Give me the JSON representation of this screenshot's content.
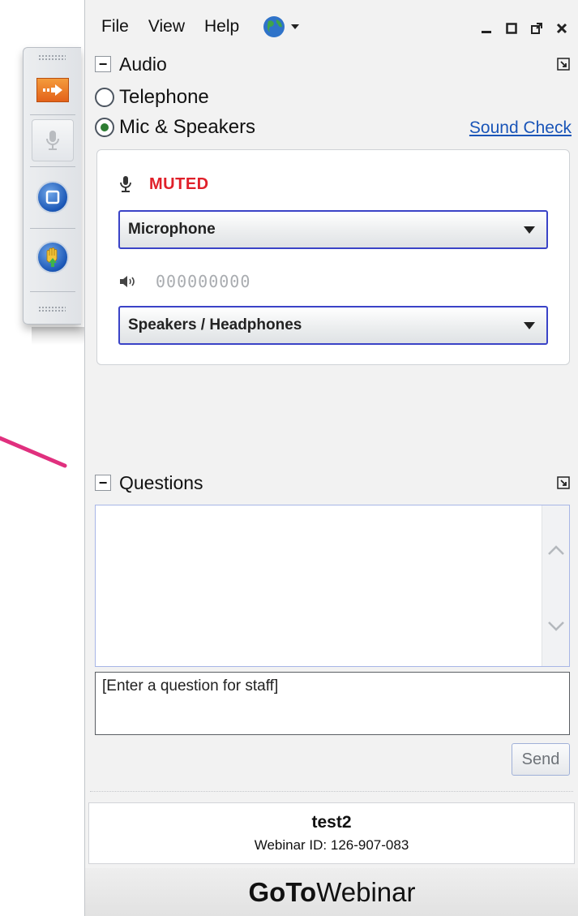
{
  "menu": {
    "file": "File",
    "view": "View",
    "help": "Help"
  },
  "audio": {
    "title": "Audio",
    "telephone_label": "Telephone",
    "mic_label": "Mic & Speakers",
    "sound_check": "Sound Check",
    "muted_label": "MUTED",
    "microphone_select": "Microphone",
    "speaker_level": "000000000",
    "speakers_select": "Speakers / Headphones",
    "selected_mode": "Mic & Speakers"
  },
  "questions": {
    "title": "Questions",
    "input_placeholder": "[Enter a question for staff]",
    "send_label": "Send"
  },
  "session": {
    "name": "test2",
    "webinar_id": "Webinar ID: 126-907-083"
  },
  "brand": {
    "bold": "GoTo",
    "regular": "Webinar"
  },
  "colors": {
    "muted_red": "#e0202a",
    "link_blue": "#1a55b8",
    "dropdown_border": "#3a43c7",
    "pointer_pink": "#e0307e"
  }
}
